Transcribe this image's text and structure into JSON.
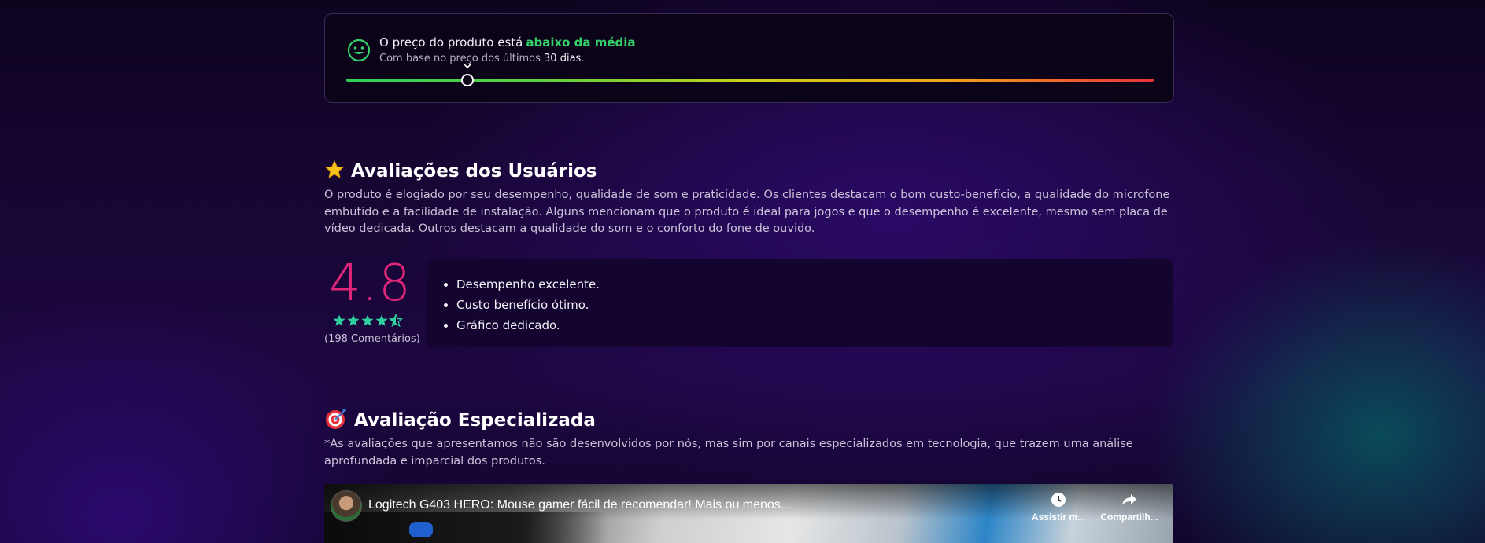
{
  "price": {
    "text": "O preço do produto está",
    "highlight": "abaixo da média",
    "sub_prefix": "Com base no preço dos últimos",
    "sub_days": "30 dias",
    "sub_suffix": ".",
    "indicator_position": 0.15,
    "colors": {
      "good": "#35d06a",
      "bad": "#e8323a"
    }
  },
  "reviews": {
    "title": "Avaliações dos Usuários",
    "icon": "star-icon",
    "summary": "O produto é elogiado por seu desempenho, qualidade de som e praticidade. Os clientes destacam o bom custo-benefício, a qualidade do microfone embutido e a facilidade de instalação. Alguns mencionam que o produto é ideal para jogos e que o desempenho é excelente, mesmo sem placa de vídeo dedicada. Outros destacam a qualidade do som e o conforto do fone de ouvido.",
    "score": "4.8",
    "stars": 4.5,
    "count": "(198 Comentários)",
    "pros": [
      "Desempenho excelente.",
      "Custo benefício ótimo.",
      "Gráfico dedicado."
    ],
    "accent": "#e0267a",
    "star_color": "#2fd0a0"
  },
  "expert": {
    "title": "Avaliação Especializada",
    "icon": "target-icon",
    "note": "*As avaliações que apresentamos não são desenvolvidos por nós, mas sim por canais especializados em tecnologia, que trazem uma análise aprofundada e imparcial dos produtos."
  },
  "video": {
    "title": "Logitech G403 HERO: Mouse gamer fácil de recomendar! Mais ou menos...",
    "watch_later": "Assistir m...",
    "share": "Compartilh..."
  }
}
